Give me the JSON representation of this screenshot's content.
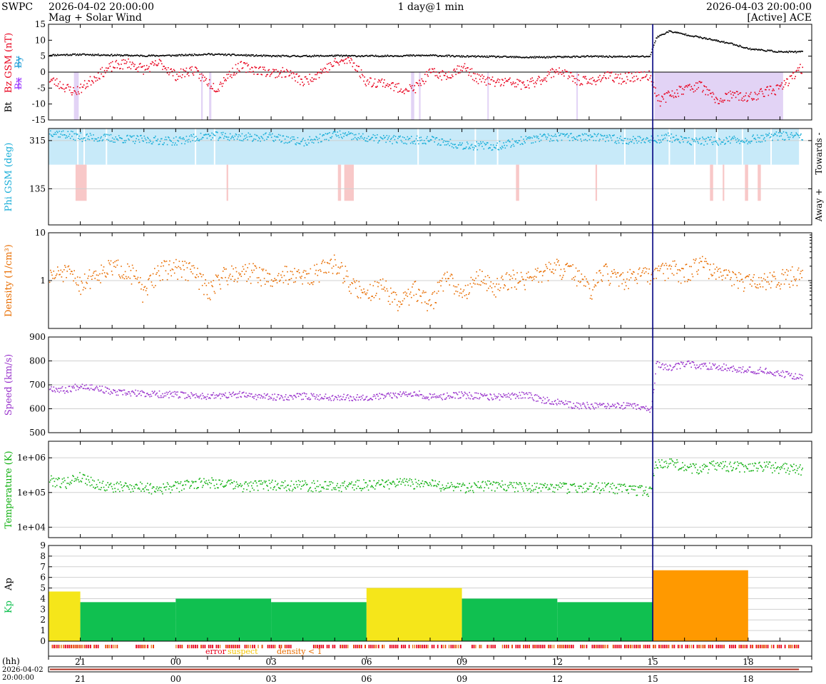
{
  "header": {
    "org": "SWPC",
    "start": "2026-04-02 20:00:00",
    "end": "2026-04-03 20:00:00",
    "resolution": "1 day@1 min",
    "subtitle": "Mag + Solar Wind",
    "source": "[Active] ACE"
  },
  "axis": {
    "hours_label": "(hh)",
    "date_label_line1": "2026-04-02",
    "date_label_line2": "20:00:00",
    "hour_ticks": [
      {
        "t": 1,
        "label": "21"
      },
      {
        "t": 4,
        "label": "00"
      },
      {
        "t": 7,
        "label": "03"
      },
      {
        "t": 10,
        "label": "06"
      },
      {
        "t": 13,
        "label": "09"
      },
      {
        "t": 16,
        "label": "12"
      },
      {
        "t": 19,
        "label": "15"
      },
      {
        "t": 22,
        "label": "18"
      }
    ],
    "now_marker_t": 19.0
  },
  "legend": {
    "error": "error",
    "suspect": "suspect",
    "density": "density < 1"
  },
  "colors": {
    "bt": "#000000",
    "bz": "#e8001c",
    "bx": "#9933ff",
    "by": "#1e9ed8",
    "phi": "#1aaed8",
    "phi_towards": "#c8eaf9",
    "phi_away": "#f8c8c8",
    "density": "#e86d00",
    "speed": "#9933cc",
    "temperature": "#10b010",
    "kp_green": "#10c050",
    "kp_yellow": "#f5e61a",
    "kp_orange": "#ff9900",
    "bz_shade": "#e2d3f5",
    "error": "#e8001c",
    "suspect": "#f5c400",
    "density_flag": "#e86d00",
    "now": "#000080"
  },
  "chart_data": [
    {
      "type": "scatter",
      "panel": "mag",
      "ylabel_parts": [
        "Bt",
        "Bz GSM (nT)",
        "Bx",
        "By"
      ],
      "ylim": [
        -15,
        15
      ],
      "yticks": [
        -15,
        -10,
        -5,
        0,
        5,
        10,
        15
      ],
      "series": [
        {
          "name": "Bt",
          "x": [
            0,
            1,
            2,
            3,
            4,
            5,
            6,
            7,
            8,
            9,
            10,
            11,
            12,
            13,
            14,
            15,
            16,
            17,
            18,
            18.9,
            19.1,
            19.5,
            20,
            20.5,
            21,
            21.5,
            22,
            22.5,
            23,
            23.6
          ],
          "values": [
            5.5,
            5.7,
            5.5,
            5.3,
            5.4,
            5.8,
            5.5,
            5.2,
            5.2,
            5.3,
            5.2,
            5.3,
            5.4,
            5.1,
            5.0,
            4.8,
            4.9,
            5.1,
            5.0,
            5.1,
            11,
            13,
            12,
            11,
            10,
            9,
            7.5,
            7,
            6.5,
            6.5
          ]
        },
        {
          "name": "Bz GSM",
          "x": [
            0,
            0.8,
            1,
            1.5,
            2,
            2.5,
            3,
            3.5,
            4,
            4.5,
            5,
            5.3,
            5.5,
            6,
            6.5,
            7,
            7.5,
            8,
            8.5,
            9,
            9.5,
            10,
            10.5,
            11,
            11.5,
            12,
            12.5,
            13,
            13.5,
            14,
            14.5,
            15,
            15.5,
            16,
            16.5,
            17,
            17.5,
            18,
            18.5,
            18.9,
            19.2,
            19.5,
            20,
            20.5,
            21,
            21.5,
            22,
            22.5,
            23,
            23.6
          ],
          "values": [
            -2,
            -6,
            -5,
            -1,
            2,
            3,
            1,
            3,
            -1,
            1,
            -3,
            -5,
            -2,
            2,
            1,
            0,
            0,
            -3,
            0,
            3,
            4,
            -3,
            -3,
            -5,
            -5,
            0,
            -1,
            2,
            -2,
            -3,
            -3,
            -4,
            -2,
            1,
            -2,
            -3,
            -1,
            -2,
            -1,
            -1,
            -9,
            -7,
            -5,
            -4,
            -9,
            -7,
            -8,
            -6,
            -5,
            1
          ]
        }
      ]
    },
    {
      "type": "scatter",
      "panel": "phi",
      "ylabel": "Phi GSM (deg)",
      "right_labels": [
        "Towards -",
        "Away +"
      ],
      "yticks": [
        135,
        315
      ],
      "series": [
        {
          "name": "Phi GSM",
          "x": [
            0,
            1,
            2,
            3,
            4,
            5,
            6,
            7,
            8,
            9,
            10,
            11,
            12,
            13,
            14,
            15,
            16,
            17,
            18,
            19,
            19.5,
            20,
            21,
            22,
            23,
            23.6
          ],
          "values": [
            350,
            330,
            325,
            320,
            315,
            335,
            330,
            330,
            310,
            340,
            325,
            320,
            320,
            300,
            295,
            320,
            330,
            330,
            320,
            320,
            330,
            315,
            315,
            320,
            335,
            330
          ]
        }
      ]
    },
    {
      "type": "scatter",
      "panel": "density",
      "ylabel": "Density (1/cm³)",
      "scale": "log",
      "ylim": [
        0.1,
        10
      ],
      "yticks": [
        1,
        10
      ],
      "series": [
        {
          "name": "Density",
          "x": [
            0,
            0.5,
            1,
            1.5,
            2,
            2.5,
            3,
            3.5,
            4,
            4.5,
            5,
            5.5,
            6,
            6.5,
            7,
            7.5,
            8,
            8.5,
            9,
            9.5,
            10,
            10.5,
            11,
            11.5,
            12,
            12.5,
            13,
            13.5,
            14,
            14.5,
            15,
            15.5,
            16,
            16.5,
            17,
            17.5,
            18,
            18.5,
            19,
            19.5,
            20,
            20.5,
            21,
            21.5,
            22,
            22.5,
            23,
            23.6
          ],
          "values": [
            1.2,
            1.6,
            0.9,
            1.5,
            2.0,
            1.8,
            0.5,
            1.8,
            2.0,
            1.7,
            0.6,
            1.4,
            1.7,
            1.6,
            1.0,
            1.5,
            1.2,
            1.7,
            2.5,
            0.8,
            0.6,
            0.8,
            0.3,
            0.7,
            0.3,
            1.2,
            0.5,
            1.3,
            0.7,
            1.2,
            1.1,
            1.5,
            2.0,
            1.5,
            0.6,
            1.6,
            1.0,
            1.4,
            1.3,
            2.0,
            1.5,
            2.5,
            1.4,
            1.1,
            1.0,
            1.0,
            1.2,
            1.5
          ]
        }
      ]
    },
    {
      "type": "scatter",
      "panel": "speed",
      "ylabel": "Speed (km/s)",
      "ylim": [
        500,
        900
      ],
      "yticks": [
        500,
        600,
        700,
        800,
        900
      ],
      "series": [
        {
          "name": "Speed",
          "x": [
            0,
            0.5,
            1,
            1.5,
            2,
            3,
            4,
            5,
            6,
            7,
            8,
            9,
            10,
            11,
            11.5,
            12,
            13,
            14,
            15,
            15.5,
            16,
            16.5,
            17,
            17.5,
            18,
            18.5,
            18.95,
            19.1,
            19.5,
            20,
            20.5,
            21,
            21.5,
            22,
            22.5,
            23,
            23.6
          ],
          "values": [
            690,
            680,
            700,
            690,
            670,
            665,
            660,
            655,
            660,
            650,
            655,
            650,
            650,
            660,
            670,
            650,
            660,
            650,
            660,
            640,
            630,
            615,
            615,
            610,
            615,
            610,
            600,
            790,
            770,
            790,
            780,
            780,
            770,
            765,
            760,
            750,
            735
          ]
        }
      ]
    },
    {
      "type": "scatter",
      "panel": "temperature",
      "ylabel": "Temperature (K)",
      "scale": "log",
      "ylim": [
        5000,
        3000000
      ],
      "yticks": [
        10000,
        100000,
        1000000
      ],
      "ytick_labels": [
        "1e+04",
        "1e+05",
        "1e+06"
      ],
      "series": [
        {
          "name": "Temperature",
          "x": [
            0,
            0.5,
            1,
            1.5,
            2,
            2.5,
            3,
            3.5,
            4,
            5,
            6,
            7,
            8,
            9,
            10,
            11,
            12,
            13,
            14,
            15,
            16,
            17,
            18,
            18.95,
            19.1,
            19.5,
            20,
            20.5,
            21,
            21.5,
            22,
            22.5,
            23,
            23.6
          ],
          "values": [
            250000,
            200000,
            300000,
            180000,
            150000,
            160000,
            150000,
            140000,
            160000,
            220000,
            160000,
            180000,
            170000,
            160000,
            180000,
            200000,
            180000,
            150000,
            170000,
            150000,
            150000,
            150000,
            140000,
            110000,
            700000,
            800000,
            600000,
            500000,
            650000,
            600000,
            550000,
            600000,
            550000,
            500000
          ]
        }
      ]
    },
    {
      "type": "bar",
      "panel": "kp",
      "ylabel_parts": [
        "Kp",
        "Ap"
      ],
      "ylim": [
        0,
        9
      ],
      "yticks": [
        0,
        1,
        2,
        3,
        4,
        5,
        6,
        7,
        8,
        9
      ],
      "bars": [
        {
          "start": 0,
          "end": 1,
          "value": 4.67,
          "level": "yellow"
        },
        {
          "start": 1,
          "end": 4,
          "value": 3.67,
          "level": "green"
        },
        {
          "start": 4,
          "end": 7,
          "value": 4.0,
          "level": "green"
        },
        {
          "start": 7,
          "end": 10,
          "value": 3.67,
          "level": "green"
        },
        {
          "start": 10,
          "end": 13,
          "value": 5.0,
          "level": "yellow"
        },
        {
          "start": 13,
          "end": 16,
          "value": 4.0,
          "level": "green"
        },
        {
          "start": 16,
          "end": 19,
          "value": 3.67,
          "level": "green"
        },
        {
          "start": 19,
          "end": 22,
          "value": 6.67,
          "level": "orange"
        }
      ]
    }
  ]
}
